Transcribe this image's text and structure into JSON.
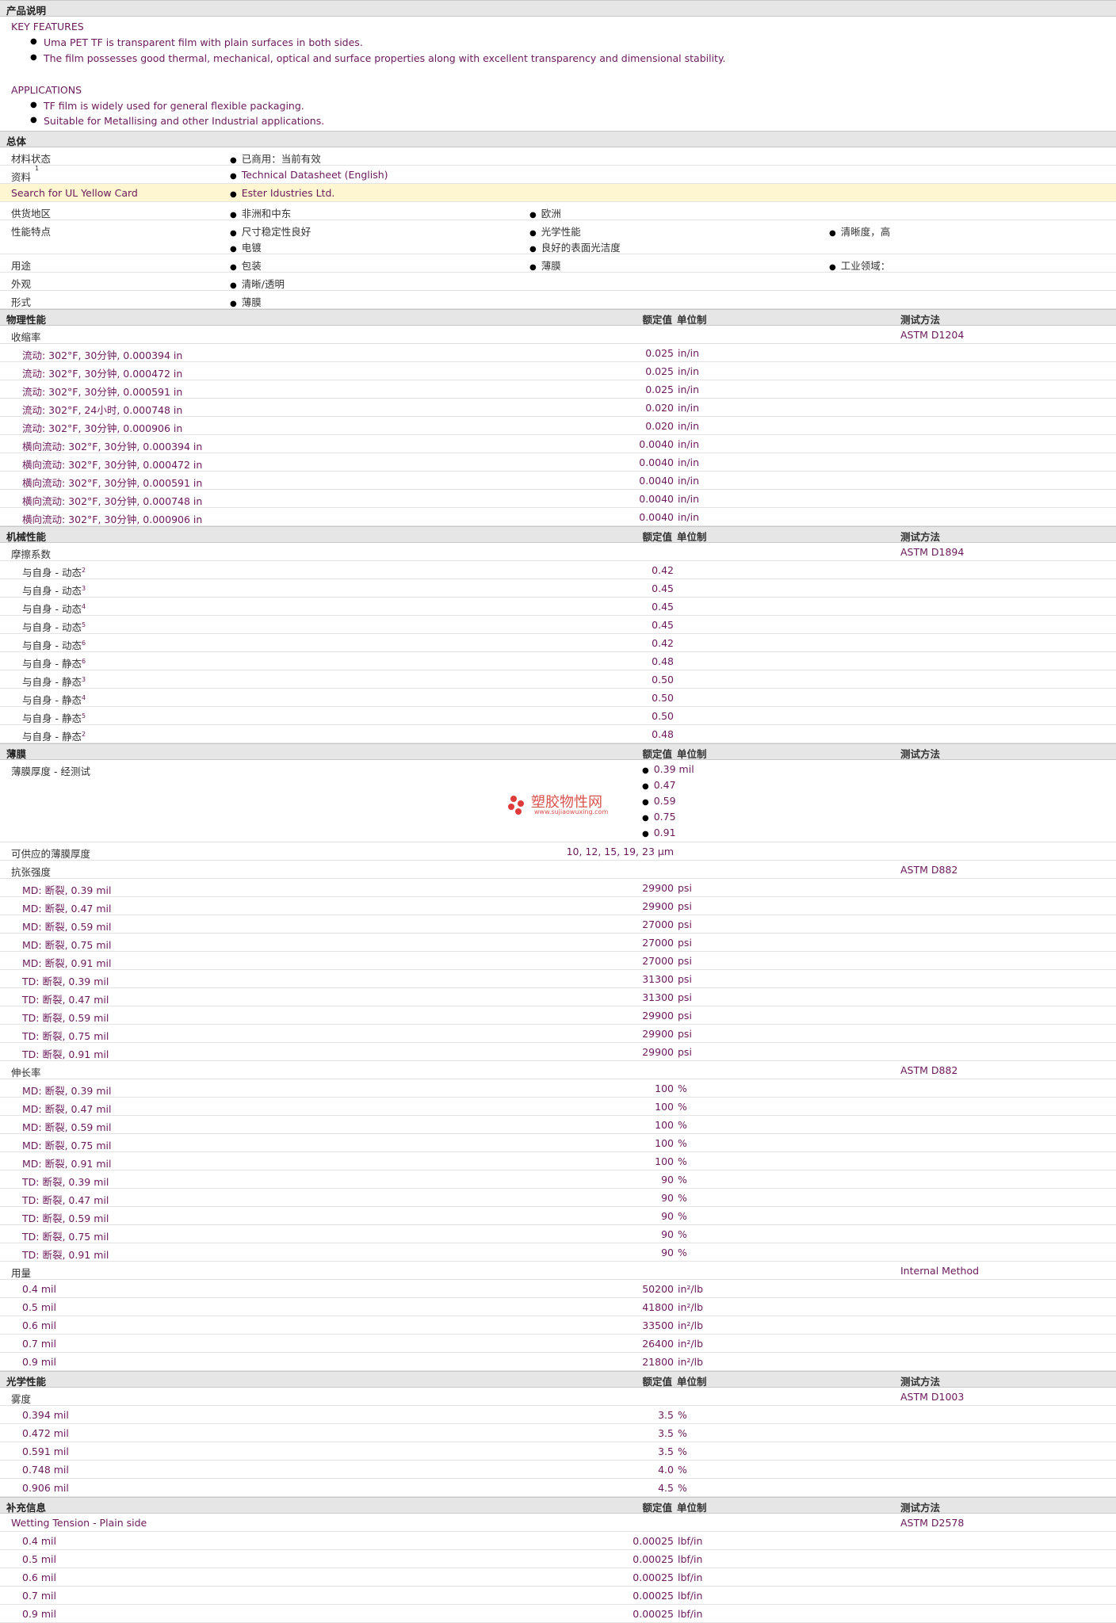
{
  "description": {
    "header": "产品说明",
    "key_features_title": "KEY FEATURES",
    "key_features": [
      "Uma PET TF is transparent film with plain surfaces in both sides.",
      "The film possesses good thermal, mechanical, optical and surface properties along with excellent transparency and dimensional stability."
    ],
    "applications_title": "APPLICATIONS",
    "applications": [
      "TF film is widely used for general flexible packaging.",
      "Suitable for Metallising and other Industrial applications."
    ]
  },
  "general": {
    "header": "总体",
    "rows": [
      {
        "label": "材料状态",
        "items": [
          "已商用：当前有效"
        ]
      },
      {
        "label": "资料",
        "label_sup": "1",
        "items": [
          "Technical Datasheet (English)"
        ],
        "link": true
      },
      {
        "label": "Search for UL Yellow Card",
        "items": [
          "Ester Idustries Ltd."
        ],
        "link": true,
        "highlight": true
      },
      {
        "label": "供货地区",
        "items": [
          "非洲和中东",
          "欧洲"
        ]
      },
      {
        "label": "性能特点",
        "items": [
          "尺寸稳定性良好",
          "光学性能",
          "清晰度，高",
          "电镀",
          "良好的表面光洁度"
        ]
      },
      {
        "label": "用途",
        "items": [
          "包装",
          "薄膜",
          "工业领域："
        ]
      },
      {
        "label": "外观",
        "items": [
          "清晰/透明"
        ]
      },
      {
        "label": "形式",
        "items": [
          "薄膜"
        ]
      }
    ]
  },
  "columns": {
    "value": "额定值",
    "unit": "单位制",
    "method": "测试方法"
  },
  "physical": {
    "header": "物理性能",
    "group": "收缩率",
    "method": "ASTM D1204",
    "rows": [
      {
        "cond": "流动: 302°F, 30分钟, 0.000394 in",
        "value": "0.025",
        "unit": "in/in"
      },
      {
        "cond": "流动: 302°F, 30分钟, 0.000472 in",
        "value": "0.025",
        "unit": "in/in"
      },
      {
        "cond": "流动: 302°F, 30分钟, 0.000591 in",
        "value": "0.025",
        "unit": "in/in"
      },
      {
        "cond": "流动: 302°F, 24小时, 0.000748 in",
        "value": "0.020",
        "unit": "in/in"
      },
      {
        "cond": "流动: 302°F, 30分钟, 0.000906 in",
        "value": "0.020",
        "unit": "in/in"
      },
      {
        "cond": "横向流动: 302°F, 30分钟, 0.000394 in",
        "value": "0.0040",
        "unit": "in/in"
      },
      {
        "cond": "横向流动: 302°F, 30分钟, 0.000472 in",
        "value": "0.0040",
        "unit": "in/in"
      },
      {
        "cond": "横向流动: 302°F, 30分钟, 0.000591 in",
        "value": "0.0040",
        "unit": "in/in"
      },
      {
        "cond": "横向流动: 302°F, 30分钟, 0.000748 in",
        "value": "0.0040",
        "unit": "in/in"
      },
      {
        "cond": "横向流动: 302°F, 30分钟, 0.000906 in",
        "value": "0.0040",
        "unit": "in/in"
      }
    ]
  },
  "mechanical": {
    "header": "机械性能",
    "group": "摩擦系数",
    "method": "ASTM D1894",
    "rows": [
      {
        "cond": "与自身 - 动态",
        "sup": "2",
        "value": "0.42"
      },
      {
        "cond": "与自身 - 动态",
        "sup": "3",
        "value": "0.45"
      },
      {
        "cond": "与自身 - 动态",
        "sup": "4",
        "value": "0.45"
      },
      {
        "cond": "与自身 - 动态",
        "sup": "5",
        "value": "0.45"
      },
      {
        "cond": "与自身 - 动态",
        "sup": "6",
        "value": "0.42"
      },
      {
        "cond": "与自身 - 静态",
        "sup": "6",
        "value": "0.48"
      },
      {
        "cond": "与自身 - 静态",
        "sup": "3",
        "value": "0.50"
      },
      {
        "cond": "与自身 - 静态",
        "sup": "4",
        "value": "0.50"
      },
      {
        "cond": "与自身 - 静态",
        "sup": "5",
        "value": "0.50"
      },
      {
        "cond": "与自身 - 静态",
        "sup": "2",
        "value": "0.48"
      }
    ]
  },
  "film": {
    "header": "薄膜",
    "thickness_label": "薄膜厚度 - 经测试",
    "thickness_values": [
      "0.39 mil",
      "0.47",
      "0.59",
      "0.75",
      "0.91"
    ],
    "watermark": {
      "name": "塑胶物性网",
      "url": "www.sujiaowuxing.com"
    },
    "available_label": "可供应的薄膜厚度",
    "available_value": "10, 12, 15, 19, 23 µm",
    "tensile": {
      "label": "抗张强度",
      "method": "ASTM D882",
      "rows": [
        {
          "cond": "MD: 断裂, 0.39 mil",
          "value": "29900",
          "unit": "psi"
        },
        {
          "cond": "MD: 断裂, 0.47 mil",
          "value": "29900",
          "unit": "psi"
        },
        {
          "cond": "MD: 断裂, 0.59 mil",
          "value": "27000",
          "unit": "psi"
        },
        {
          "cond": "MD: 断裂, 0.75 mil",
          "value": "27000",
          "unit": "psi"
        },
        {
          "cond": "MD: 断裂, 0.91 mil",
          "value": "27000",
          "unit": "psi"
        },
        {
          "cond": "TD: 断裂, 0.39 mil",
          "value": "31300",
          "unit": "psi"
        },
        {
          "cond": "TD: 断裂, 0.47 mil",
          "value": "31300",
          "unit": "psi"
        },
        {
          "cond": "TD: 断裂, 0.59 mil",
          "value": "29900",
          "unit": "psi"
        },
        {
          "cond": "TD: 断裂, 0.75 mil",
          "value": "29900",
          "unit": "psi"
        },
        {
          "cond": "TD: 断裂, 0.91 mil",
          "value": "29900",
          "unit": "psi"
        }
      ]
    },
    "elongation": {
      "label": "伸长率",
      "method": "ASTM D882",
      "rows": [
        {
          "cond": "MD: 断裂, 0.39 mil",
          "value": "100",
          "unit": "%"
        },
        {
          "cond": "MD: 断裂, 0.47 mil",
          "value": "100",
          "unit": "%"
        },
        {
          "cond": "MD: 断裂, 0.59 mil",
          "value": "100",
          "unit": "%"
        },
        {
          "cond": "MD: 断裂, 0.75 mil",
          "value": "100",
          "unit": "%"
        },
        {
          "cond": "MD: 断裂, 0.91 mil",
          "value": "100",
          "unit": "%"
        },
        {
          "cond": "TD: 断裂, 0.39 mil",
          "value": "90",
          "unit": "%"
        },
        {
          "cond": "TD: 断裂, 0.47 mil",
          "value": "90",
          "unit": "%"
        },
        {
          "cond": "TD: 断裂, 0.59 mil",
          "value": "90",
          "unit": "%"
        },
        {
          "cond": "TD: 断裂, 0.75 mil",
          "value": "90",
          "unit": "%"
        },
        {
          "cond": "TD: 断裂, 0.91 mil",
          "value": "90",
          "unit": "%"
        }
      ]
    },
    "yield": {
      "label": "用量",
      "method": "Internal Method",
      "rows": [
        {
          "cond": "0.4 mil",
          "value": "50200",
          "unit": "in²/lb"
        },
        {
          "cond": "0.5 mil",
          "value": "41800",
          "unit": "in²/lb"
        },
        {
          "cond": "0.6 mil",
          "value": "33500",
          "unit": "in²/lb"
        },
        {
          "cond": "0.7 mil",
          "value": "26400",
          "unit": "in²/lb"
        },
        {
          "cond": "0.9 mil",
          "value": "21800",
          "unit": "in²/lb"
        }
      ]
    }
  },
  "optical": {
    "header": "光学性能",
    "group": "雾度",
    "method": "ASTM D1003",
    "rows": [
      {
        "cond": "0.394 mil",
        "value": "3.5",
        "unit": "%"
      },
      {
        "cond": "0.472 mil",
        "value": "3.5",
        "unit": "%"
      },
      {
        "cond": "0.591 mil",
        "value": "3.5",
        "unit": "%"
      },
      {
        "cond": "0.748 mil",
        "value": "4.0",
        "unit": "%"
      },
      {
        "cond": "0.906 mil",
        "value": "4.5",
        "unit": "%"
      }
    ]
  },
  "supplementary": {
    "header": "补充信息",
    "group": "Wetting Tension - Plain side",
    "method": "ASTM D2578",
    "rows": [
      {
        "cond": "0.4 mil",
        "value": "0.00025",
        "unit": "lbf/in"
      },
      {
        "cond": "0.5 mil",
        "value": "0.00025",
        "unit": "lbf/in"
      },
      {
        "cond": "0.6 mil",
        "value": "0.00025",
        "unit": "lbf/in"
      },
      {
        "cond": "0.7 mil",
        "value": "0.00025",
        "unit": "lbf/in"
      },
      {
        "cond": "0.9 mil",
        "value": "0.00025",
        "unit": "lbf/in"
      }
    ]
  }
}
